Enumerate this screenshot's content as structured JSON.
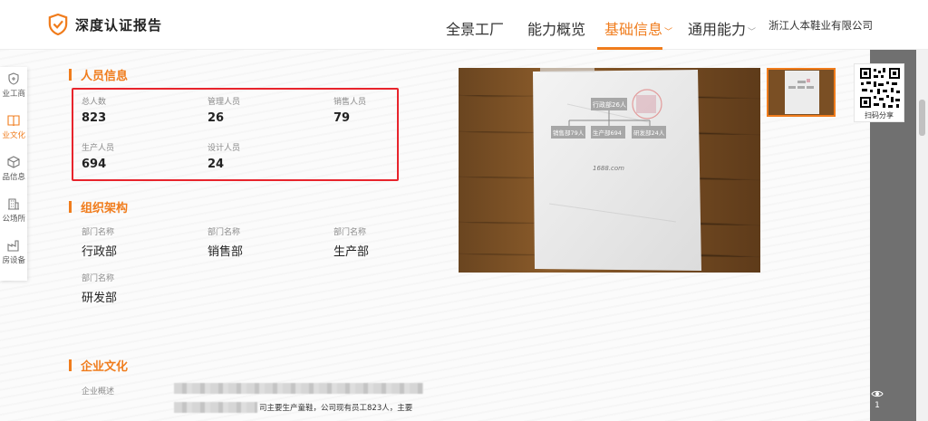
{
  "header": {
    "logo_text": "深度认证报告",
    "nav": [
      {
        "label": "全景工厂",
        "active": false,
        "has_caret": false
      },
      {
        "label": "能力概览",
        "active": false,
        "has_caret": false
      },
      {
        "label": "基础信息",
        "active": true,
        "has_caret": true
      },
      {
        "label": "通用能力",
        "active": false,
        "has_caret": true
      }
    ],
    "company_name": "浙江人本鞋业有限公司",
    "accent_color": "#f07c1c"
  },
  "sidenav": {
    "items": [
      {
        "label": "业工商",
        "icon": "shield-icon",
        "active": false
      },
      {
        "label": "业文化",
        "icon": "book-icon",
        "active": true
      },
      {
        "label": "品信息",
        "icon": "box-icon",
        "active": false
      },
      {
        "label": "公场所",
        "icon": "building-icon",
        "active": false
      },
      {
        "label": "房设备",
        "icon": "factory-icon",
        "active": false
      }
    ]
  },
  "personnel": {
    "title": "人员信息",
    "fields": [
      {
        "label": "总人数",
        "value": "823"
      },
      {
        "label": "管理人员",
        "value": "26"
      },
      {
        "label": "销售人员",
        "value": "79"
      },
      {
        "label": "生产人员",
        "value": "694"
      },
      {
        "label": "设计人员",
        "value": "24"
      }
    ]
  },
  "org": {
    "title": "组织架构",
    "departments": [
      {
        "label": "部门名称",
        "value": "行政部"
      },
      {
        "label": "部门名称",
        "value": "销售部"
      },
      {
        "label": "部门名称",
        "value": "生产部"
      },
      {
        "label": "部门名称",
        "value": "研发部"
      }
    ]
  },
  "culture": {
    "title": "企业文化",
    "overview_label": "企业概述",
    "overview_text": "司主要生产童鞋，公司现有员工823人，主要"
  },
  "preview": {
    "photo_chart_nodes": [
      "行政部26人",
      "销售部79人",
      "生产部694",
      "研发部24人"
    ],
    "photo_watermark": "1688.com",
    "share_label": "扫码分享"
  },
  "views": {
    "count": "1"
  }
}
